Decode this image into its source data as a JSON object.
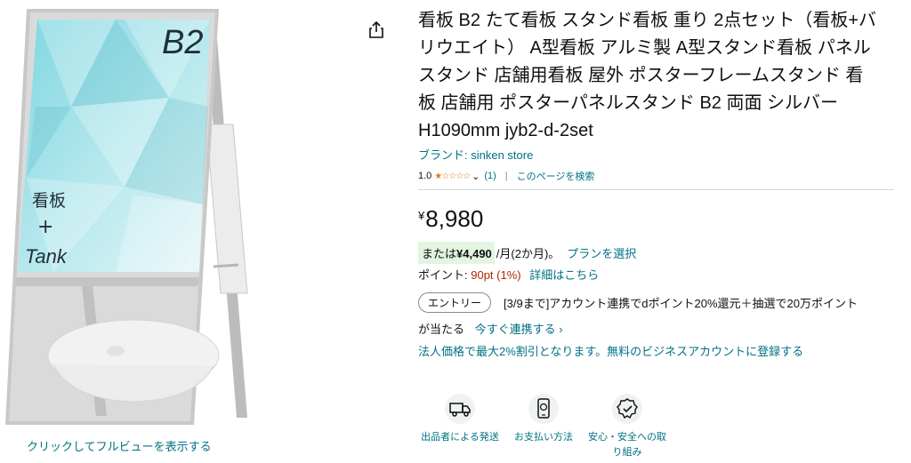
{
  "product": {
    "title": "看板 B2 たて看板 スタンド看板 重り 2点セット（看板+バリウエイト） A型看板 アルミ製 A型スタンド看板 パネルスタンド 店舗用看板 屋外 ポスターフレームスタンド 看板 店舗用 ポスターパネルスタンド B2 両面 シルバー H1090mm jyb2-d-2set",
    "brand": "ブランド: sinken store",
    "image_text": {
      "size": "B2",
      "line1": "看板",
      "line2": "+",
      "line3": "Tank"
    },
    "view_full": "クリックしてフルビューを表示する"
  },
  "rating": {
    "score": "1.0",
    "stars": "★☆☆☆☆",
    "count": "(1)",
    "separator": "|",
    "search_page": "このページを検索"
  },
  "price": {
    "currency": "¥",
    "amount": "8,980"
  },
  "installment": {
    "prefix": "または",
    "amount": "¥4,490",
    "suffix": "/月(2か月)。",
    "plan_link": "プランを選択"
  },
  "points": {
    "label": "ポイント: ",
    "value": "90pt",
    "percent": "(1%)",
    "detail_link": "詳細はこちら"
  },
  "campaign": {
    "entry_button": "エントリー",
    "line1": "[3/9まで]アカウント連携でdポイント20%還元＋抽選で20万ポイント",
    "line2": "が当たる",
    "link": "今すぐ連携する ›"
  },
  "corporate": "法人価格で最大2%割引となります。無料のビジネスアカウントに登録する",
  "features": [
    {
      "icon": "delivery-truck-icon",
      "label": "出品者による発送"
    },
    {
      "icon": "payment-phone-icon",
      "label": "お支払い方法"
    },
    {
      "icon": "security-badge-icon",
      "label": "安心・安全への取り組み"
    }
  ],
  "colors": {
    "link": "#007185",
    "star": "#de7921",
    "price_red": "#b12704",
    "badge_bg": "#e3f5e1"
  }
}
